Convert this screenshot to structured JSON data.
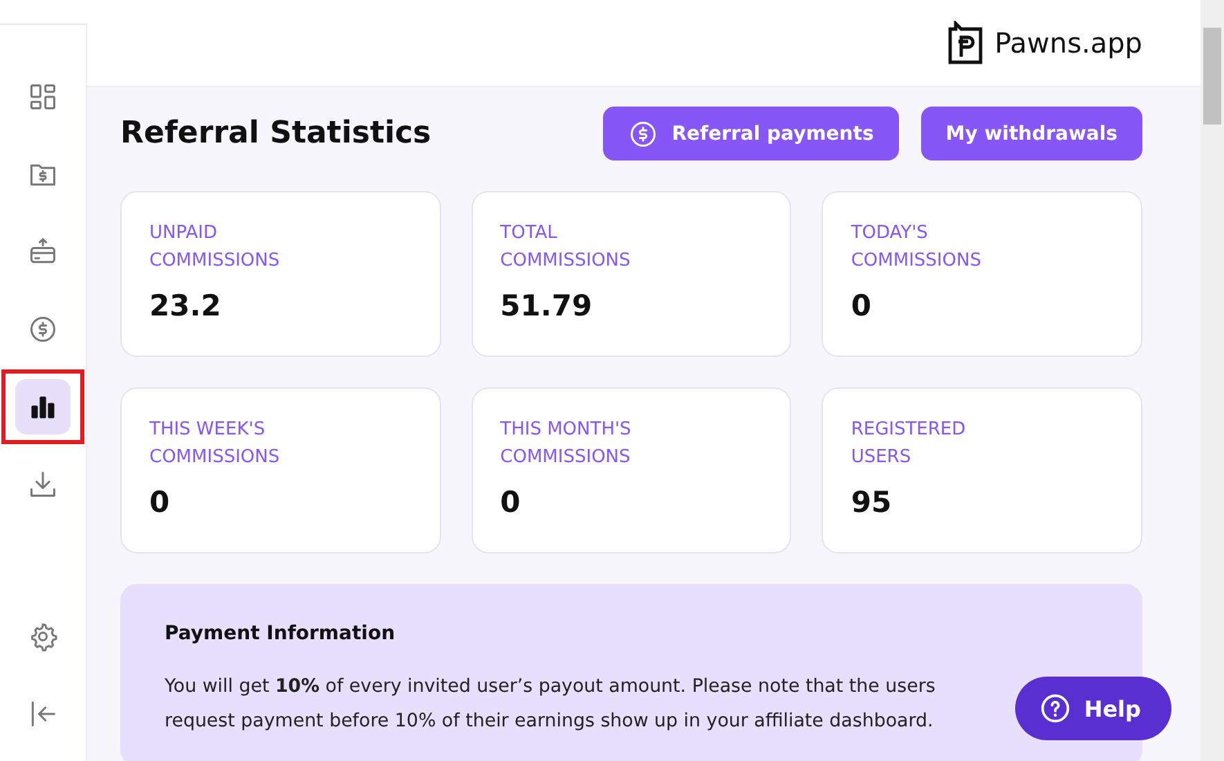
{
  "sidebar": {
    "items": [
      {
        "kind": "dashboard",
        "selected": false,
        "highlighted": false
      },
      {
        "kind": "folder",
        "selected": false,
        "highlighted": false
      },
      {
        "kind": "card",
        "selected": false,
        "highlighted": false
      },
      {
        "kind": "coin",
        "selected": false,
        "highlighted": false
      },
      {
        "kind": "chart",
        "selected": true,
        "highlighted": true
      },
      {
        "kind": "download",
        "selected": false,
        "highlighted": false
      }
    ],
    "bottom_items": [
      {
        "kind": "settings"
      },
      {
        "kind": "logout"
      }
    ]
  },
  "header": {
    "logo_text": "Pawns.app"
  },
  "page": {
    "title": "Referral Statistics",
    "buttons": [
      {
        "label": "Referral payments",
        "kind": "icon"
      },
      {
        "label": "My withdrawals",
        "kind": "plain"
      }
    ]
  },
  "stats": [
    {
      "label": "UNPAID",
      "label2": "COMMISSIONS",
      "value": "23.2"
    },
    {
      "label": "TOTAL",
      "label2": "COMMISSIONS",
      "value": "51.79"
    },
    {
      "label": "TODAY'S",
      "label2": "COMMISSIONS",
      "value": "0"
    },
    {
      "label": "THIS WEEK'S",
      "label2": "COMMISSIONS",
      "value": "0"
    },
    {
      "label": "THIS MONTH'S",
      "label2": "COMMISSIONS",
      "value": "0"
    },
    {
      "label": "REGISTERED",
      "label2": "USERS",
      "value": "95"
    }
  ],
  "payment_info": {
    "title": "Payment Information",
    "lines": [
      "You will get **10%** of every invited user’s payout amount. Please note that the users",
      "request payment before 10% of their earnings show up in your affiliate dashboard."
    ]
  },
  "help_button": {
    "label": "Help"
  }
}
